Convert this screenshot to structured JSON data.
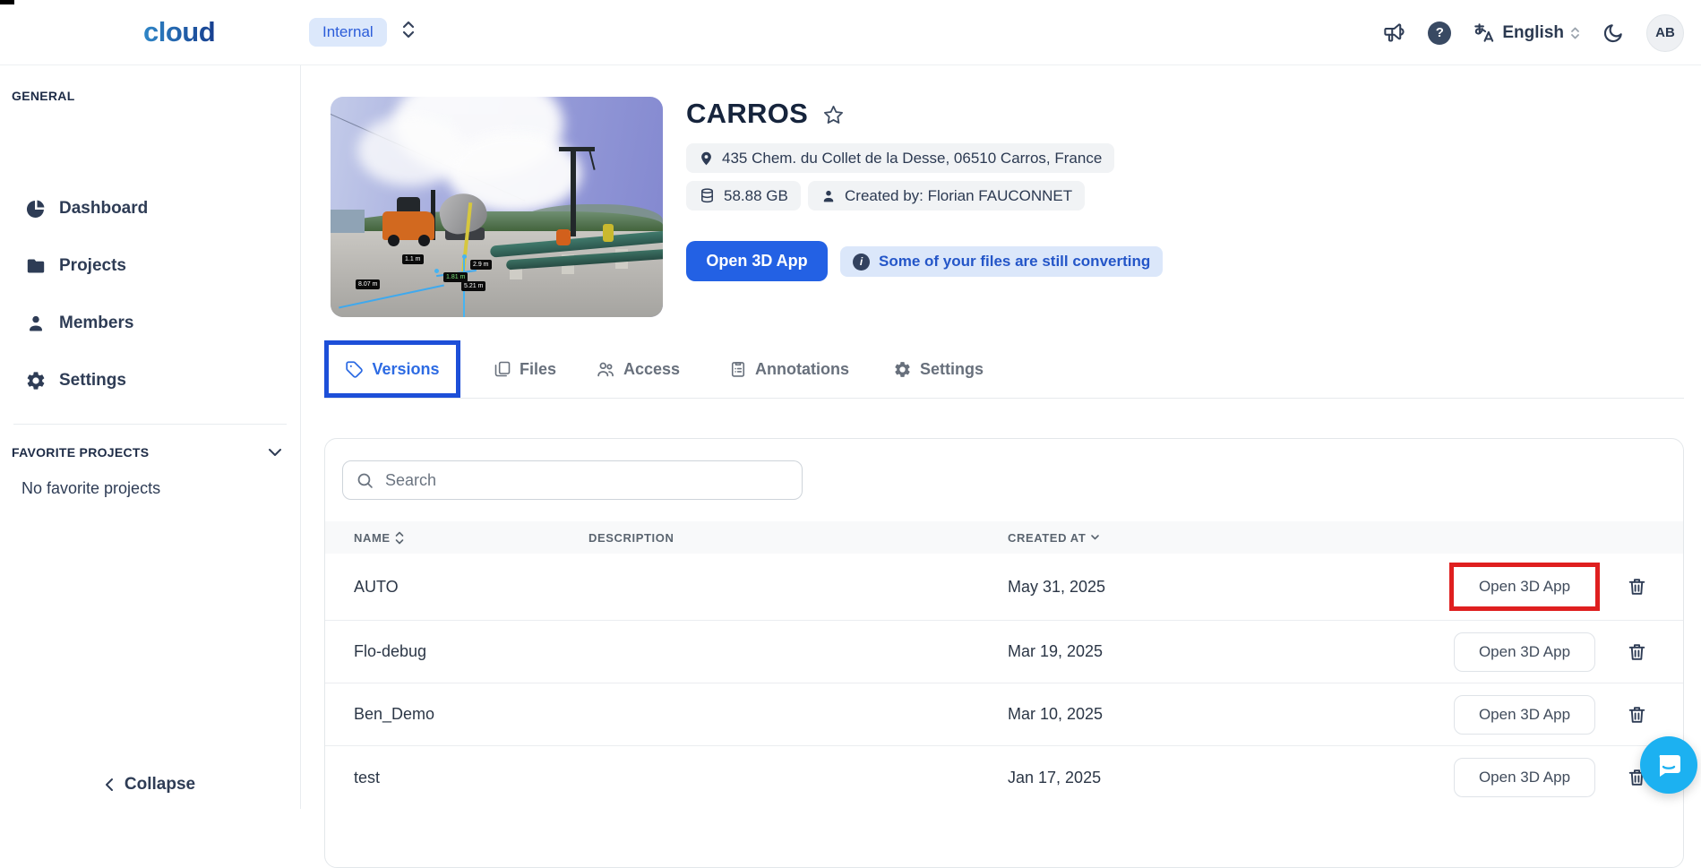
{
  "topbar": {
    "logo": "cloud",
    "workspace_badge": "Internal",
    "language": "English",
    "avatar_initials": "AB",
    "help_glyph": "?"
  },
  "sidebar": {
    "general_header": "GENERAL",
    "items": [
      {
        "label": "Dashboard",
        "icon": "pie-chart-icon"
      },
      {
        "label": "Projects",
        "icon": "folder-icon"
      },
      {
        "label": "Members",
        "icon": "person-icon"
      },
      {
        "label": "Settings",
        "icon": "gear-icon"
      }
    ],
    "favorites_header": "FAVORITE PROJECTS",
    "favorites_empty": "No favorite projects",
    "collapse_label": "Collapse"
  },
  "project": {
    "title": "CARROS",
    "address": "435 Chem. du Collet de la Desse, 06510 Carros, France",
    "size": "58.88 GB",
    "created_by": "Created by: Florian FAUCONNET",
    "open_app_label": "Open 3D App",
    "converting_notice": "Some of your files are still converting",
    "info_glyph": "i",
    "thumbnail_measure_labels": {
      "a": "8.07 m",
      "b": "1.1 m",
      "c": "2.9 m",
      "d": "1.81 m",
      "e": "5.21 m"
    }
  },
  "tabs": [
    {
      "label": "Versions",
      "icon": "tag-icon",
      "active": true
    },
    {
      "label": "Files",
      "icon": "files-icon",
      "active": false
    },
    {
      "label": "Access",
      "icon": "users-icon",
      "active": false
    },
    {
      "label": "Annotations",
      "icon": "clipboard-icon",
      "active": false
    },
    {
      "label": "Settings",
      "icon": "gear-icon",
      "active": false
    }
  ],
  "versions_table": {
    "search_placeholder": "Search",
    "columns": {
      "name": "NAME",
      "description": "DESCRIPTION",
      "created_at": "CREATED AT"
    },
    "rows": [
      {
        "name": "AUTO",
        "description": "",
        "created_at": "May 31, 2025",
        "action": "Open 3D App",
        "highlighted": true
      },
      {
        "name": "Flo-debug",
        "description": "",
        "created_at": "Mar 19, 2025",
        "action": "Open 3D App",
        "highlighted": false
      },
      {
        "name": "Ben_Demo",
        "description": "",
        "created_at": "Mar 10, 2025",
        "action": "Open 3D App",
        "highlighted": false
      },
      {
        "name": "test",
        "description": "",
        "created_at": "Jan 17, 2025",
        "action": "Open 3D App",
        "highlighted": false
      }
    ]
  },
  "colors": {
    "primary_blue": "#2361e4",
    "active_tab_blue": "#2d6be3",
    "annotation_blue_box": "#1d4fd8",
    "annotation_red_box": "#df1f1f",
    "notice_bg": "#dbe7fa",
    "notice_text": "#2456c8",
    "badge_bg": "#f1f3f5",
    "chat_bubble": "#1cb1f1",
    "dark_navy_text": "#2e3c55"
  }
}
